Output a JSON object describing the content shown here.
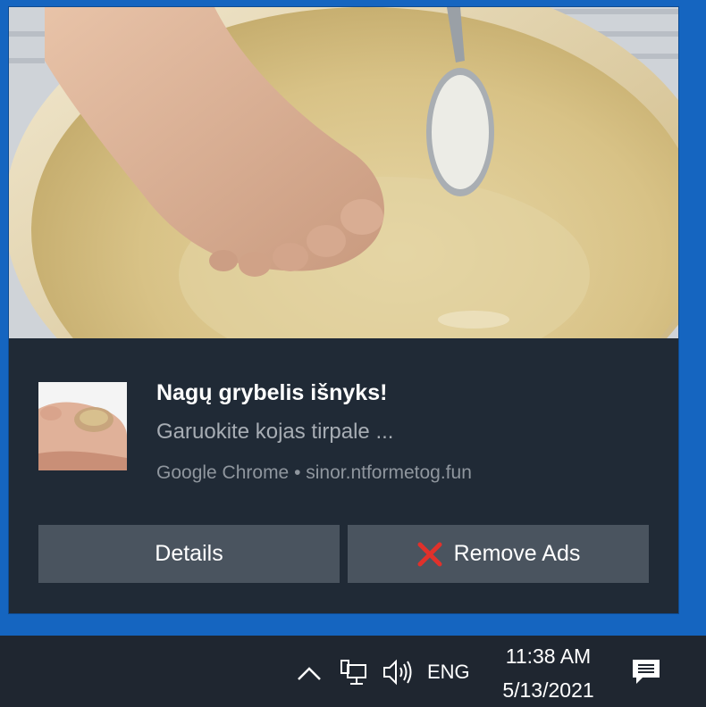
{
  "toast": {
    "title": "Nagų grybelis išnyks!",
    "body": "Garuokite kojas tirpale ...",
    "attribution": "Google Chrome • sinor.ntformetog.fun",
    "hero_image": "foot-in-basin-photo",
    "app_logo": "toenail-photo",
    "buttons": {
      "details_label": "Details",
      "remove_label": "Remove Ads",
      "remove_icon": "red-x-icon"
    }
  },
  "taskbar": {
    "chevron_icon": "chevron-up-icon",
    "network_icon": "network-icon",
    "volume_icon": "speaker-icon",
    "language": "ENG",
    "time": "11:38 AM",
    "date": "5/13/2021",
    "action_center_icon": "action-center-icon"
  },
  "colors": {
    "desktop_blue": "#1565c0",
    "toast_bg": "#202a36",
    "button_bg": "#4a545f",
    "taskbar_bg": "#1f2630",
    "remove_x": "#e0312b"
  }
}
